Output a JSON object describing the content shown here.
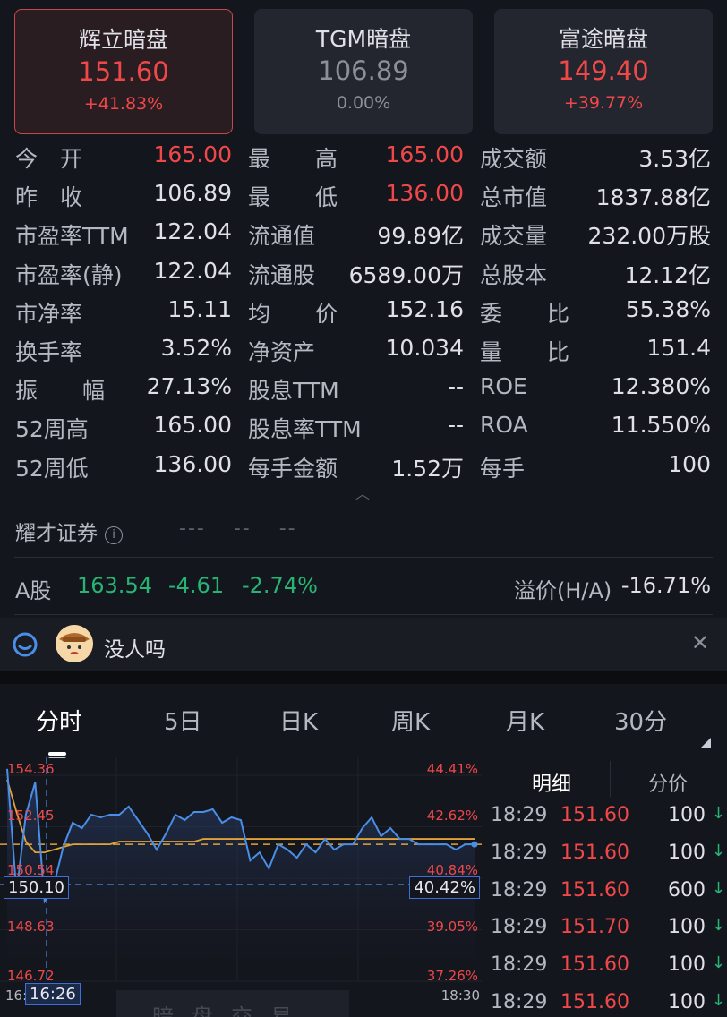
{
  "dark_pools": [
    {
      "name": "辉立暗盘",
      "price": "151.60",
      "change": "+41.83%",
      "active": true,
      "tone": "up"
    },
    {
      "name": "TGM暗盘",
      "price": "106.89",
      "change": "0.00%",
      "active": false,
      "tone": "dim"
    },
    {
      "name": "富途暗盘",
      "price": "149.40",
      "change": "+39.77%",
      "active": false,
      "tone": "up"
    }
  ],
  "stats": [
    [
      [
        "今　开",
        "165.00",
        "up"
      ],
      [
        "最　　高",
        "165.00",
        "up"
      ],
      [
        "成交额",
        "3.53亿"
      ]
    ],
    [
      [
        "昨　收",
        "106.89",
        "n"
      ],
      [
        "最　　低",
        "136.00",
        "up"
      ],
      [
        "总市值",
        "1837.88亿"
      ]
    ],
    [
      [
        "市盈率TTM",
        "122.04",
        "n"
      ],
      [
        "流通值",
        "99.89亿",
        "n"
      ],
      [
        "成交量",
        "232.00万股"
      ]
    ],
    [
      [
        "市盈率(静)",
        "122.04",
        "n"
      ],
      [
        "流通股",
        "6589.00万",
        "n"
      ],
      [
        "总股本",
        "12.12亿"
      ]
    ],
    [
      [
        "市净率",
        "15.11",
        "n"
      ],
      [
        "均　　价",
        "152.16",
        "n"
      ],
      [
        "委　　比",
        "55.38%"
      ]
    ],
    [
      [
        "换手率",
        "3.52%",
        "n"
      ],
      [
        "净资产",
        "10.034",
        "n"
      ],
      [
        "量　　比",
        "151.4"
      ]
    ],
    [
      [
        "振　　幅",
        "27.13%",
        "n"
      ],
      [
        "股息TTM",
        "--",
        "n"
      ],
      [
        "ROE",
        "12.380%"
      ]
    ],
    [
      [
        "52周高",
        "165.00",
        "n"
      ],
      [
        "股息率TTM",
        "--",
        "n"
      ],
      [
        "ROA",
        "11.550%"
      ]
    ],
    [
      [
        "52周低",
        "136.00",
        "n"
      ],
      [
        "每手金额",
        "1.52万",
        "n"
      ],
      [
        "每手",
        "100"
      ]
    ]
  ],
  "broker": {
    "label": "耀才证券",
    "values": [
      "---",
      "--",
      "--"
    ]
  },
  "a_share": {
    "label": "A股",
    "price": "163.54",
    "change": "-4.61",
    "pct": "-2.74%",
    "premium_label": "溢价(H/A)",
    "premium": "-16.71%"
  },
  "chat": {
    "text": "没人吗"
  },
  "tabs": [
    "分时",
    "5日",
    "日K",
    "周K",
    "月K",
    "30分"
  ],
  "chart_axis": {
    "y_left": [
      "154.36",
      "152.45",
      "150.54",
      "148.63",
      "146.72"
    ],
    "y_right": [
      "44.41%",
      "42.62%",
      "40.84%",
      "39.05%",
      "37.26%"
    ],
    "cursor_price": "150.10",
    "cursor_pct": "40.42%",
    "cursor_time": "16:26",
    "x_start": "16:",
    "x_end": "18:30",
    "ghost_text": "暗盘交易"
  },
  "chart_data": {
    "type": "line",
    "ylim": [
      146.72,
      154.36
    ],
    "ylabel": "",
    "xlabel": "",
    "baseline": 151.6,
    "series": [
      {
        "values": [
          154.4,
          149.8,
          152.7,
          153.9,
          149.5,
          150.1,
          151.5,
          152.4,
          152.2,
          152.7,
          152.6,
          152.7,
          152.7,
          153.0,
          152.5,
          152.0,
          151.4,
          152.0,
          152.7,
          152.5,
          152.8,
          152.8,
          152.9,
          152.4,
          152.6,
          152.5,
          151.0,
          151.3,
          150.7,
          151.6,
          151.4,
          151.1,
          151.6,
          151.3,
          151.8,
          151.4,
          151.6,
          151.6,
          152.2,
          152.6,
          151.9,
          152.2,
          151.8,
          151.8,
          151.6,
          151.6,
          151.6,
          151.6,
          151.4,
          151.6,
          151.6
        ]
      },
      {
        "values": [
          154.0,
          152.8,
          151.7,
          151.3,
          151.3,
          151.4,
          151.5,
          151.6,
          151.6,
          151.6,
          151.6,
          151.6,
          151.7,
          151.7,
          151.7,
          151.7,
          151.7,
          151.7,
          151.7,
          151.7,
          151.7,
          151.8,
          151.8,
          151.8,
          151.8,
          151.8,
          151.8,
          151.8,
          151.8,
          151.8,
          151.8,
          151.8,
          151.8,
          151.8,
          151.8,
          151.8,
          151.8,
          151.8,
          151.8,
          151.8,
          151.8,
          151.8,
          151.8,
          151.8,
          151.8,
          151.8,
          151.8,
          151.8,
          151.8,
          151.8,
          151.8
        ]
      }
    ]
  },
  "detail": {
    "head": "明细",
    "head2": "分价",
    "rows": [
      {
        "time": "18:29",
        "price": "151.60",
        "vol": "100"
      },
      {
        "time": "18:29",
        "price": "151.60",
        "vol": "100"
      },
      {
        "time": "18:29",
        "price": "151.60",
        "vol": "600"
      },
      {
        "time": "18:29",
        "price": "151.70",
        "vol": "100"
      },
      {
        "time": "18:29",
        "price": "151.60",
        "vol": "100"
      },
      {
        "time": "18:29",
        "price": "151.60",
        "vol": "100"
      }
    ]
  },
  "colors": {
    "up": "#f04848",
    "down": "#27b574",
    "line": "#4a8ee8",
    "avg": "#e2a23a"
  }
}
